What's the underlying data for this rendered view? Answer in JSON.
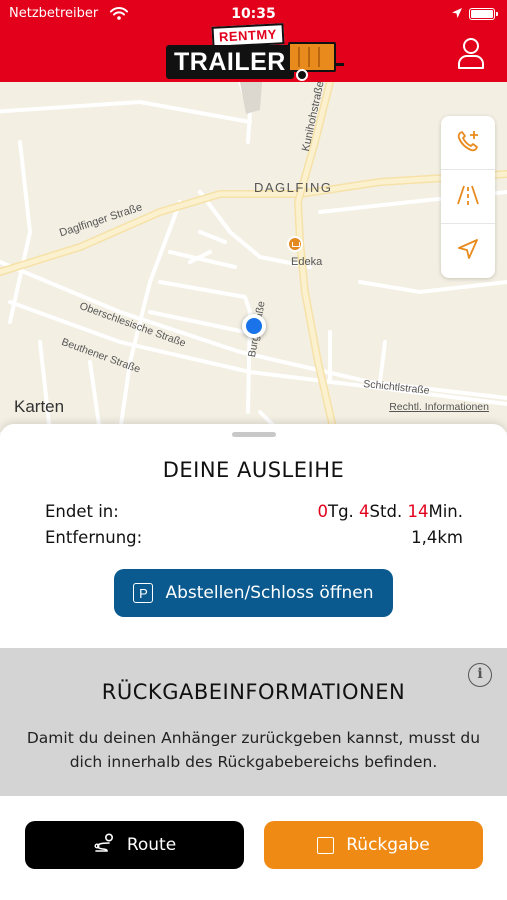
{
  "status_bar": {
    "carrier": "Netzbetreiber",
    "time": "10:35",
    "icons": [
      "wifi-icon",
      "location-arrow-icon",
      "battery-icon"
    ]
  },
  "header": {
    "logo_top": "RENTMY",
    "logo_main": "TRAILER",
    "profile_icon": "user-icon",
    "bg_color": "#e3001b"
  },
  "map": {
    "labels": {
      "district": "DAGLFING",
      "daglfinger": "Daglfinger Straße",
      "kunihoh": "Kunihohstraße",
      "oberschlesische": "Oberschlesische Straße",
      "beuthener": "Beuthener Straße",
      "burg": "Burg Straße",
      "schichtl": "Schichtlstraße",
      "poi": "Edeka"
    },
    "attribution": "Karten",
    "legal": "Rechtl. Informationen",
    "controls": [
      "call-add-icon",
      "road-icon",
      "navigation-arrow-icon"
    ]
  },
  "rental": {
    "title": "DEINE AUSLEIHE",
    "ends_label": "Endet in:",
    "days_value": "0",
    "days_unit": "Tg.",
    "hours_value": "4",
    "hours_unit": "Std.",
    "minutes_value": "14",
    "minutes_unit": "Min.",
    "distance_label": "Entfernung:",
    "distance_value": "1,4km",
    "park_button_icon": "P",
    "park_button": "Abstellen/Schloss öffnen"
  },
  "return_info": {
    "title": "RÜCKGABEINFORMATIONEN",
    "text": "Damit du deinen Anhänger zurückgeben kannst, musst du dich innerhalb des Rückgabebereichs befinden.",
    "info_icon": "i"
  },
  "footer": {
    "route_button": "Route",
    "return_button": "Rückgabe"
  },
  "colors": {
    "brand_red": "#e3001b",
    "accent_orange": "#ef8a14",
    "park_blue": "#0a5a8f",
    "info_gray": "#d4d4d4"
  }
}
